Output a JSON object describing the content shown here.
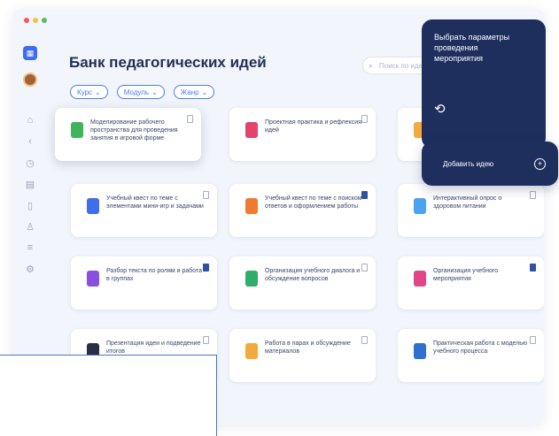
{
  "app": {
    "title": "Банк педагогических идей",
    "search_placeholder": "Поиск по идеям",
    "filters": [
      {
        "label": "Курс"
      },
      {
        "label": "Модуль"
      },
      {
        "label": "Жанр"
      }
    ]
  },
  "popup": {
    "text": "Выбрать параметры проведения мероприятия",
    "add_label": "Добавить идею"
  },
  "cards": [
    {
      "text": "Моделирование рабочего пространства для проведения занятия в игровой форме",
      "color": "#3fb45a",
      "icon": "tablet-icon",
      "bookmarked": false
    },
    {
      "text": "Проектная практика и рефлексия идей",
      "color": "#e2446a",
      "icon": "slides-icon",
      "bookmarked": false
    },
    {
      "text": "",
      "color": "#f3a93b",
      "icon": "lightbulb-icon",
      "bookmarked": false
    },
    {
      "text": "Учебный квест по теме с элементами мини-игр и задачами",
      "color": "#3f6ee8",
      "icon": "calculator-icon",
      "bookmarked": false
    },
    {
      "text": "Учебный квест по теме с поиском ответов и оформлением работы",
      "color": "#f07a2e",
      "icon": "bars-icon",
      "bookmarked": true
    },
    {
      "text": "Интерактивный опрос о здоровом питании",
      "color": "#4aa3f0",
      "icon": "mic-icon",
      "bookmarked": false
    },
    {
      "text": "Разбор текста по ролям и работа в группах",
      "color": "#8a4fe0",
      "icon": "pen-icon",
      "bookmarked": true
    },
    {
      "text": "Организация учебного диалога и обсуждение вопросов",
      "color": "#2fae6a",
      "icon": "book-icon",
      "bookmarked": false
    },
    {
      "text": "Организация учебного мероприятия",
      "color": "#e0468a",
      "icon": "monitor-icon",
      "bookmarked": true
    },
    {
      "text": "Презентация идеи и подведение итогов",
      "color": "#2a2f45",
      "icon": "cap-icon",
      "bookmarked": false
    },
    {
      "text": "Работа в парах и обсуждение материалов",
      "color": "#f3a93b",
      "icon": "gallery-icon",
      "bookmarked": false
    },
    {
      "text": "Практическая работа с моделью учебного процесса",
      "color": "#2f6fd0",
      "icon": "screen-icon",
      "bookmarked": false
    }
  ],
  "colors": {
    "accent": "#4b7cf3",
    "dark_panel": "#1e2f5e",
    "window_bg": "#f2f5fb"
  }
}
